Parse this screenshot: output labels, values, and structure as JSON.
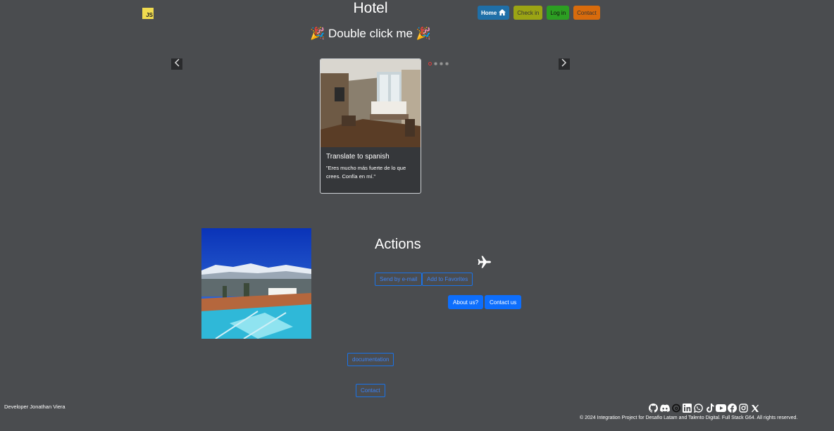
{
  "header": {
    "logo_text": "JS",
    "title": "Hotel",
    "nav": {
      "home": "Home",
      "check_in": "Check in",
      "log_in": "Log in",
      "contact": "Contact"
    },
    "double_click": "🎉 Double click me 🎉"
  },
  "carousel": {
    "card_title": "Translate to spanish",
    "card_text": "\"Eres mucho más fuerte de lo que crees. Confía en mí.\"",
    "indicator_count": 4,
    "active_index": 0
  },
  "actions": {
    "heading": "Actions",
    "send_email": "Send by e-mail",
    "add_favorites": "Add to Favorites",
    "about_us": "About us?",
    "contact_us": "Contact us"
  },
  "links": {
    "documentation": "documentation",
    "contact": "Contact"
  },
  "footer": {
    "developer": "Developer Jonathan Viera",
    "copyright": "© 2024 Integration Project for Desafio Latam and Talento Digital. Full Stack G64. All rights reserved.",
    "social_icons": [
      "github-icon",
      "discord-icon",
      "threads-icon",
      "linkedin-icon",
      "whatsapp-icon",
      "tiktok-icon",
      "youtube-icon",
      "facebook-icon",
      "instagram-icon",
      "x-icon"
    ]
  },
  "colors": {
    "background": "#4a4c4f",
    "home": "#1f6fa8",
    "check_in": "#9ba414",
    "log_in": "#2c9e22",
    "contact": "#d86b0c",
    "primary": "#0d6efd"
  }
}
